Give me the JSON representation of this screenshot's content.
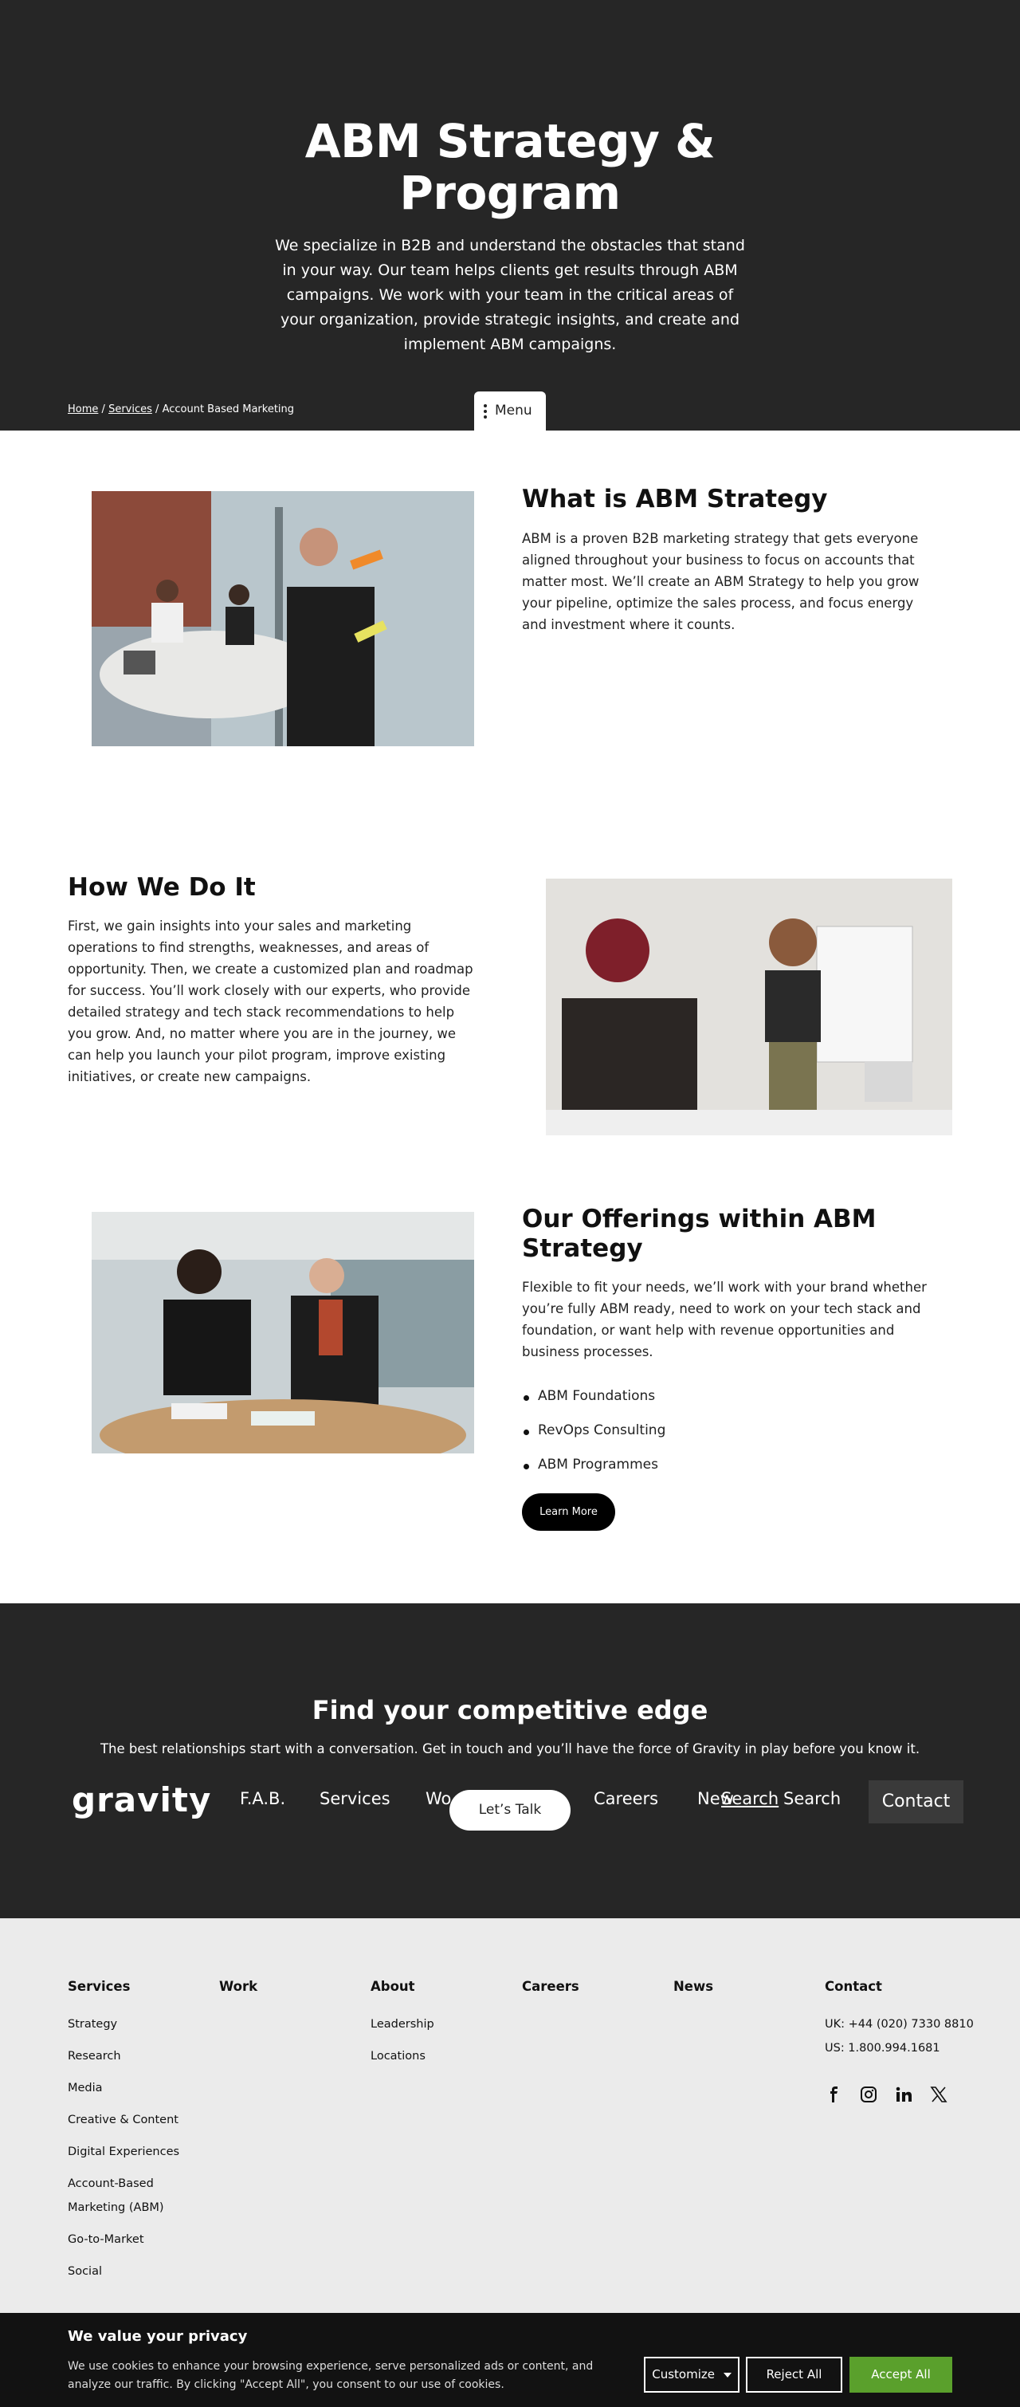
{
  "hero": {
    "title": "ABM Strategy & Program",
    "intro": "We specialize in B2B and understand the obstacles that stand in your way. Our team helps clients get results through ABM campaigns. We work with your team in the critical areas of your organization, provide strategic insights, and create and implement ABM campaigns."
  },
  "breadcrumb": {
    "home": "Home",
    "services": "Services",
    "current": "Account Based Marketing",
    "sep": "/"
  },
  "menu": {
    "label": "Menu"
  },
  "what": {
    "title": "What is ABM Strategy",
    "body": "ABM is a proven B2B marketing strategy that gets everyone aligned throughout your business to focus on accounts that matter most. We’ll create an ABM Strategy to help you grow your pipeline, optimize the sales process, and focus energy and investment where it counts."
  },
  "how": {
    "title": "How We Do It",
    "body": "First, we gain insights into your sales and marketing operations to find strengths, weaknesses, and areas of opportunity. Then, we create a customized plan and roadmap for success. You’ll work closely with our experts, who provide detailed strategy and tech stack recommendations to help you grow. And, no matter where you are in the journey, we can help you launch your pilot program, improve existing initiatives, or create new campaigns."
  },
  "offerings": {
    "title": "Our Offerings within ABM Strategy",
    "body": "Flexible to fit your needs, we’ll work with your brand whether you’re fully ABM ready, need to work on your tech stack and foundation, or want help with revenue opportunities and business processes.",
    "items": [
      "ABM Foundations",
      "RevOps Consulting",
      "ABM Programmes"
    ],
    "cta": "Learn More"
  },
  "cta_band": {
    "title": "Find your competitive edge",
    "text": "The best relationships start with a conversation. Get in touch and you’ll have the force of Gravity in play before you know it."
  },
  "nav": {
    "logo": "gravity",
    "fab": "F.A.B.",
    "services": "Services",
    "work": "Wo",
    "talk": "Let’s Talk",
    "careers": "Careers",
    "news": "New",
    "search_placeholder": "Search",
    "search": "Search",
    "contact": "Contact"
  },
  "footer": {
    "services": {
      "heading": "Services",
      "links": [
        "Strategy",
        "Research",
        "Media",
        "Creative & Content",
        "Digital Experiences",
        "Account-Based Marketing (ABM)",
        "Go-to-Market",
        "Social"
      ]
    },
    "work": {
      "heading": "Work"
    },
    "about": {
      "heading": "About",
      "links": [
        "Leadership",
        "Locations"
      ]
    },
    "careers": {
      "heading": "Careers"
    },
    "news": {
      "heading": "News"
    },
    "contact": {
      "heading": "Contact",
      "uk": "UK: +44 (020) 7330 8810",
      "us": "US: 1.800.994.1681"
    },
    "social_icons": [
      "facebook-icon",
      "instagram-icon",
      "linkedin-icon",
      "x-icon"
    ]
  },
  "cookie": {
    "title": "We value your privacy",
    "text": "We use cookies to enhance your browsing experience, serve personalized ads or content, and analyze our traffic. By clicking \"Accept All\", you consent to our use of cookies.",
    "customize": "Customize",
    "reject": "Reject All",
    "accept": "Accept All"
  },
  "colors": {
    "dark": "#262626",
    "accept": "#5aa02c",
    "footer_bg": "#ebebeb"
  }
}
